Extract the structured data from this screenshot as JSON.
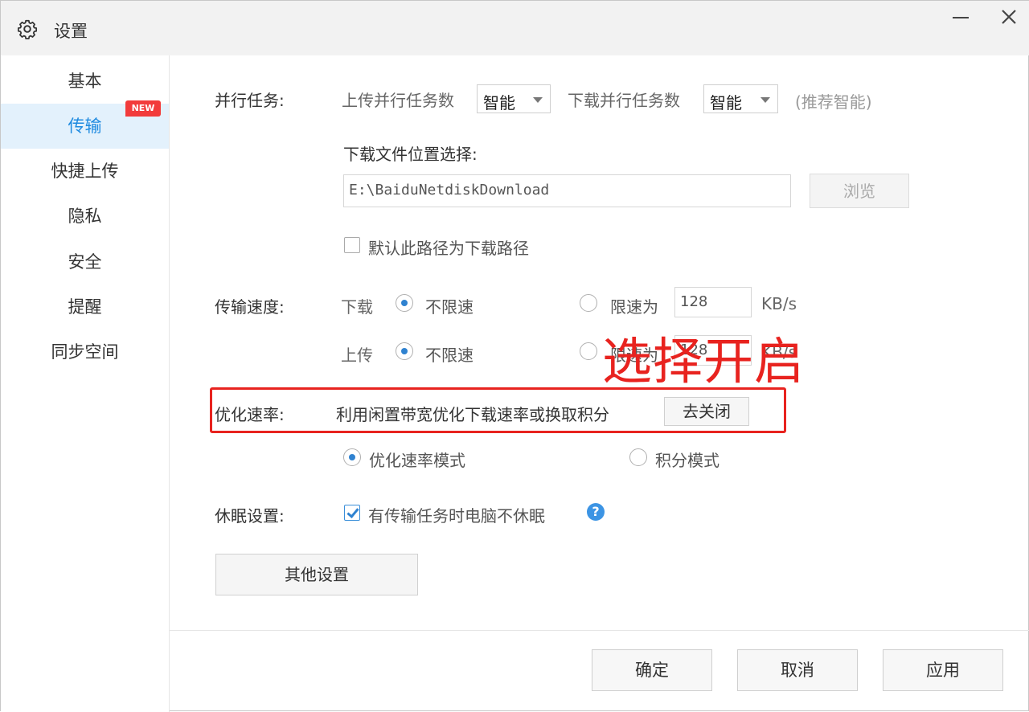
{
  "window": {
    "title": "设置",
    "title_icon": "gear-icon",
    "minimize_icon": "minimize-icon",
    "close_icon": "close-icon"
  },
  "sidebar": {
    "items": [
      {
        "label": "基本",
        "active": false
      },
      {
        "label": "传输",
        "active": true
      },
      {
        "label": "快捷上传",
        "active": false,
        "badge": "NEW"
      },
      {
        "label": "隐私",
        "active": false
      },
      {
        "label": "安全",
        "active": false
      },
      {
        "label": "提醒",
        "active": false
      },
      {
        "label": "同步空间",
        "active": false
      }
    ]
  },
  "parallel": {
    "label": "并行任务:",
    "upload_label": "上传并行任务数",
    "upload_value": "智能",
    "download_label": "下载并行任务数",
    "download_value": "智能",
    "hint": "(推荐智能)"
  },
  "download_location": {
    "label": "下载文件位置选择:",
    "path": "E:\\BaiduNetdiskDownload",
    "browse_label": "浏览",
    "default_checkbox_label": "默认此路径为下载路径",
    "default_checked": false
  },
  "speed": {
    "label": "传输速度:",
    "download_label": "下载",
    "upload_label": "上传",
    "unlimited_label": "不限速",
    "limit_label": "限速为",
    "download_limit_value": "128",
    "upload_limit_value": "128",
    "unit": "KB/s",
    "download_mode": "unlimited",
    "upload_mode": "unlimited"
  },
  "optimize": {
    "label": "优化速率:",
    "description": "利用闲置带宽优化下载速率或换取积分",
    "toggle_button_label": "去关闭",
    "mode_speed_label": "优化速率模式",
    "mode_points_label": "积分模式",
    "selected_mode": "speed"
  },
  "annotation": {
    "text": "选择开启",
    "color": "#e8231f"
  },
  "sleep": {
    "label": "休眠设置:",
    "checkbox_label": "有传输任务时电脑不休眠",
    "checked": true,
    "help_glyph": "?"
  },
  "other_settings_label": "其他设置",
  "footer": {
    "ok_label": "确定",
    "cancel_label": "取消",
    "apply_label": "应用"
  },
  "colors": {
    "accent": "#1e8ae0",
    "active_bg": "#e3f1fc",
    "badge": "#f23b3b",
    "highlight": "#e8231f"
  }
}
